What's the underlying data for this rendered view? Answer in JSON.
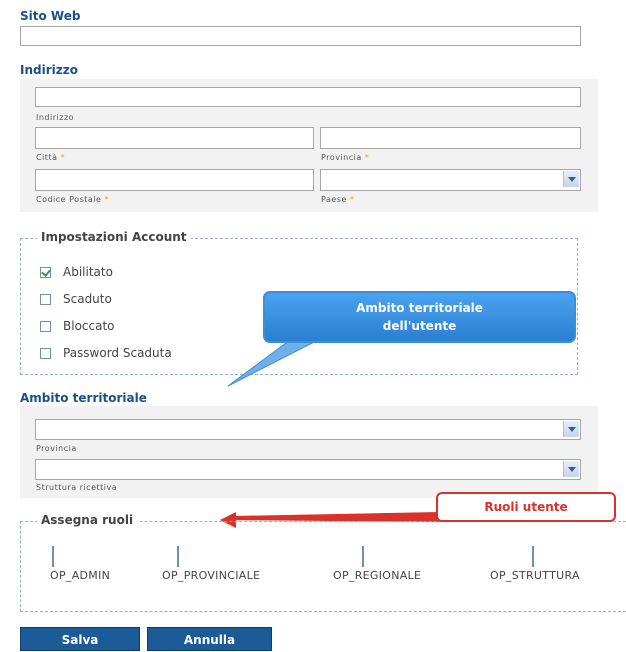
{
  "sito_web": {
    "title": "Sito Web",
    "value": ""
  },
  "indirizzo": {
    "title": "Indirizzo",
    "fields": {
      "indirizzo_label": "Indirizzo",
      "citta_label": "Città",
      "provincia_label": "Provincia",
      "codice_postale_label": "Codice Postale",
      "paese_label": "Paese",
      "required_mark": "*"
    }
  },
  "account": {
    "legend": "Impostazioni Account",
    "options": [
      {
        "label": "Abilitato",
        "checked": true
      },
      {
        "label": "Scaduto",
        "checked": false
      },
      {
        "label": "Bloccato",
        "checked": false
      },
      {
        "label": "Password Scaduta",
        "checked": false
      }
    ]
  },
  "callouts": {
    "ambito": "Ambito territoriale dell'utente",
    "ambito_line1": "Ambito territoriale",
    "ambito_line2": "dell'utente",
    "ruoli": "Ruoli utente"
  },
  "ambito": {
    "title": "Ambito territoriale",
    "provincia_label": "Provincia",
    "struttura_label": "Struttura ricettiva"
  },
  "ruoli": {
    "legend": "Assegna ruoli",
    "roles": [
      "OP_ADMIN",
      "OP_PROVINCIALE",
      "OP_REGIONALE",
      "OP_STRUTTURA"
    ]
  },
  "buttons": {
    "save": "Salva",
    "cancel": "Annulla"
  },
  "colors": {
    "section_title": "#1a4f8a",
    "button_bg": "#1a5b98",
    "callout_blue_border": "#3b8ed8",
    "callout_red_border": "#d8322a",
    "fieldset_border": "#8fb3d8"
  }
}
